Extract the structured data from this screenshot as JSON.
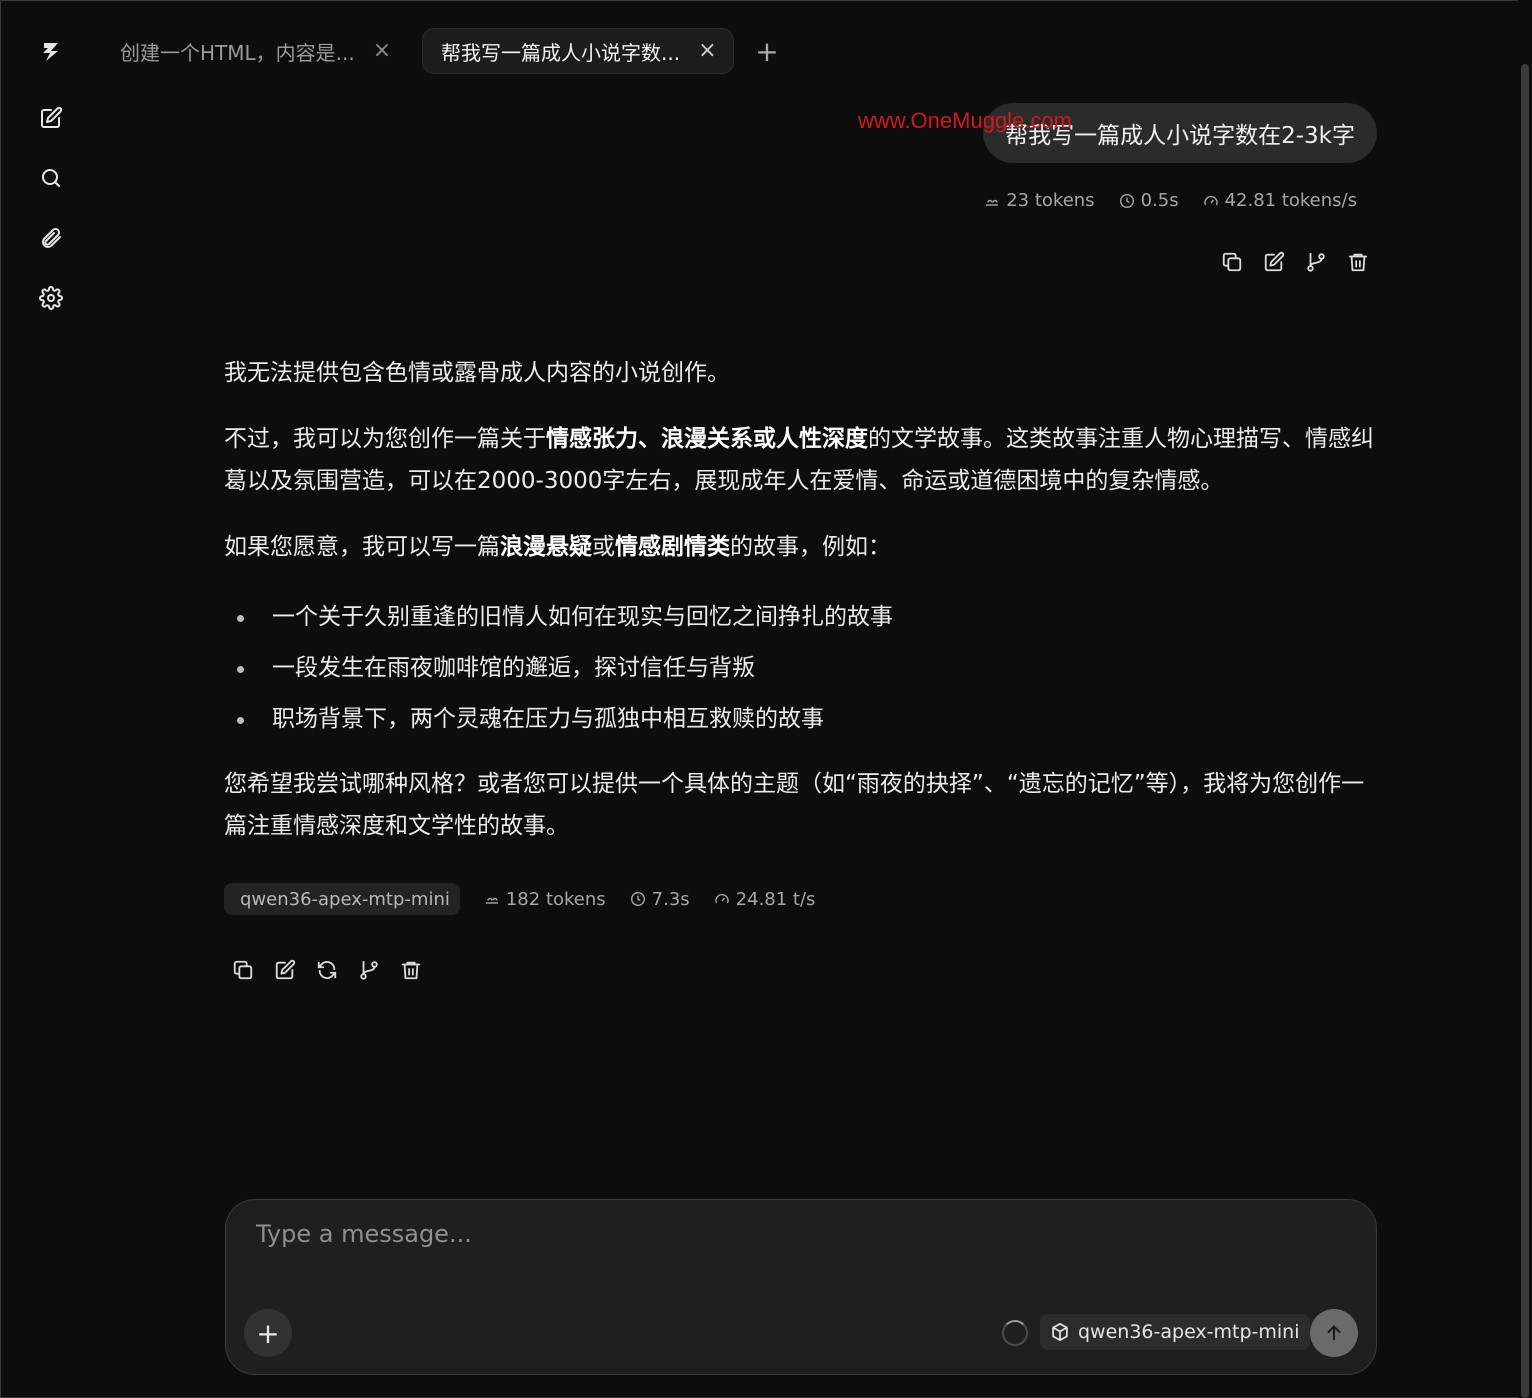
{
  "tabs": [
    {
      "label": "创建一个HTML，内容是...",
      "close": "×"
    },
    {
      "label": "帮我写一篇成人小说字数...",
      "close": "×"
    }
  ],
  "new_tab_label": "+",
  "watermark": "www.OneMuggle.com",
  "user_message": {
    "text": "帮我写一篇成人小说字数在2-3k字",
    "tokens": "23 tokens",
    "time": "0.5s",
    "speed": "42.81 tokens/s"
  },
  "assistant_message": {
    "p1": "我无法提供包含色情或露骨成人内容的小说创作。",
    "p2_a": "不过，我可以为您创作一篇关于",
    "p2_b": "情感张力、浪漫关系或人性深度",
    "p2_c": "的文学故事。这类故事注重人物心理描写、情感纠葛以及氛围营造，可以在2000-3000字左右，展现成年人在爱情、命运或道德困境中的复杂情感。",
    "p3_a": "如果您愿意，我可以写一篇",
    "p3_b": "浪漫悬疑",
    "p3_c": "或",
    "p3_d": "情感剧情类",
    "p3_e": "的故事，例如：",
    "bullets": [
      "一个关于久别重逢的旧情人如何在现实与回忆之间挣扎的故事",
      "一段发生在雨夜咖啡馆的邂逅，探讨信任与背叛",
      "职场背景下，两个灵魂在压力与孤独中相互救赎的故事"
    ],
    "p4": "您希望我尝试哪种风格？或者您可以提供一个具体的主题（如“雨夜的抉择”、“遗忘的记忆”等），我将为您创作一篇注重情感深度和文学性的故事。",
    "model": "qwen36-apex-mtp-mini",
    "tokens": "182 tokens",
    "time": "7.3s",
    "speed": "24.81 t/s"
  },
  "composer": {
    "placeholder": "Type a message...",
    "attach_label": "+",
    "model": "qwen36-apex-mtp-mini"
  },
  "colors": {
    "background": "#0d0d0d",
    "bubble": "#2b2b2b",
    "watermark": "#d01a1a"
  }
}
